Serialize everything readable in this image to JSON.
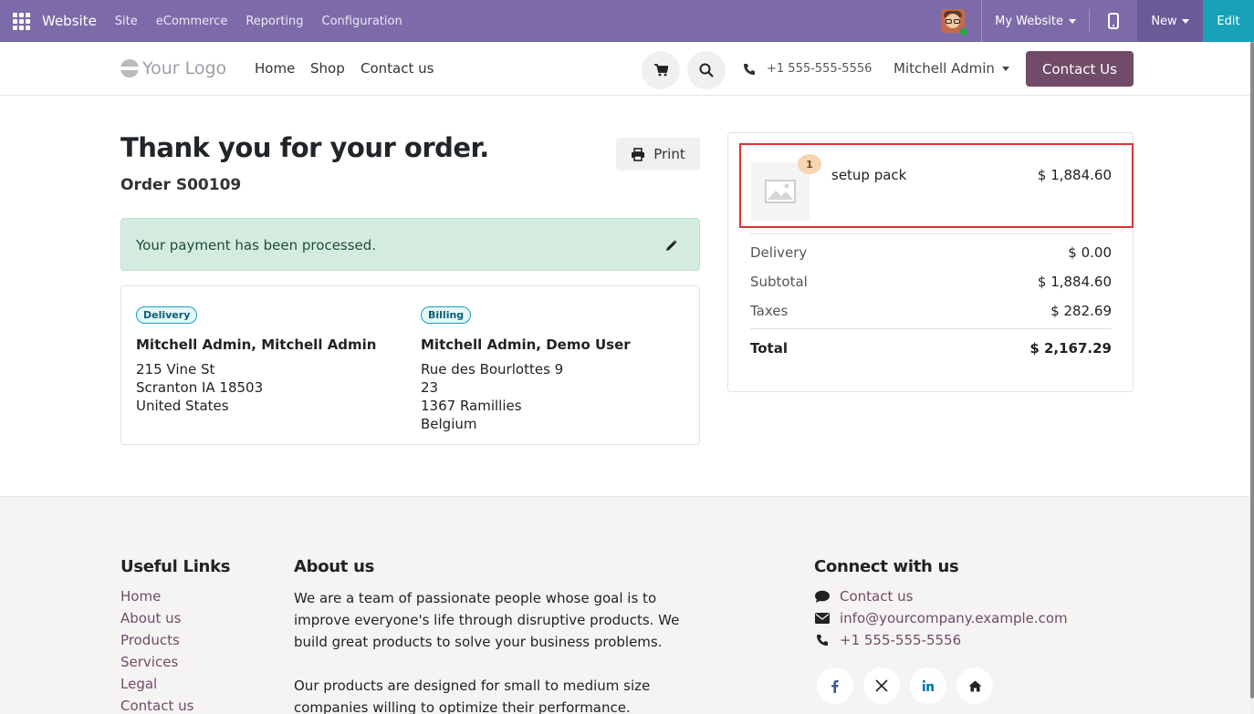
{
  "adminbar": {
    "app_name": "Website",
    "menus": [
      "Site",
      "eCommerce",
      "Reporting",
      "Configuration"
    ],
    "my_website": "My Website",
    "new_label": "New",
    "edit_label": "Edit"
  },
  "header": {
    "logo_text": "Your Logo",
    "nav": [
      "Home",
      "Shop",
      "Contact us"
    ],
    "phone": "+1 555-555-5556",
    "user": "Mitchell Admin",
    "contact_button": "Contact Us"
  },
  "order": {
    "title": "Thank you for your order.",
    "number": "Order S00109",
    "print_label": "Print",
    "alert": "Your payment has been processed.",
    "delivery": {
      "badge": "Delivery",
      "name": "Mitchell Admin, Mitchell Admin",
      "lines": [
        "215 Vine St",
        "Scranton IA 18503",
        "United States"
      ]
    },
    "billing": {
      "badge": "Billing",
      "name": "Mitchell Admin, Demo User",
      "lines": [
        "Rue des Bourlottes 9",
        "23",
        "1367 Ramillies",
        "Belgium"
      ]
    }
  },
  "summary": {
    "item": {
      "qty": "1",
      "name": "setup pack",
      "price": "$ 1,884.60"
    },
    "rows": [
      {
        "label": "Delivery",
        "value": "$ 0.00"
      },
      {
        "label": "Subtotal",
        "value": "$ 1,884.60"
      },
      {
        "label": "Taxes",
        "value": "$ 282.69"
      }
    ],
    "total": {
      "label": "Total",
      "value": "$ 2,167.29"
    }
  },
  "footer": {
    "useful_links_title": "Useful Links",
    "links": [
      "Home",
      "About us",
      "Products",
      "Services",
      "Legal",
      "Contact us"
    ],
    "about_title": "About us",
    "about_p1": "We are a team of passionate people whose goal is to improve everyone's life through disruptive products. We build great products to solve your business problems.",
    "about_p2": "Our products are designed for small to medium size companies willing to optimize their performance.",
    "connect_title": "Connect with us",
    "connect": [
      "Contact us",
      "info@yourcompany.example.com",
      "+1 555-555-5556"
    ]
  },
  "colors": {
    "admin_bar": "#7c6ba8",
    "brand": "#714b67",
    "edit": "#17a2b8",
    "success_bg": "#d4ecdf"
  }
}
